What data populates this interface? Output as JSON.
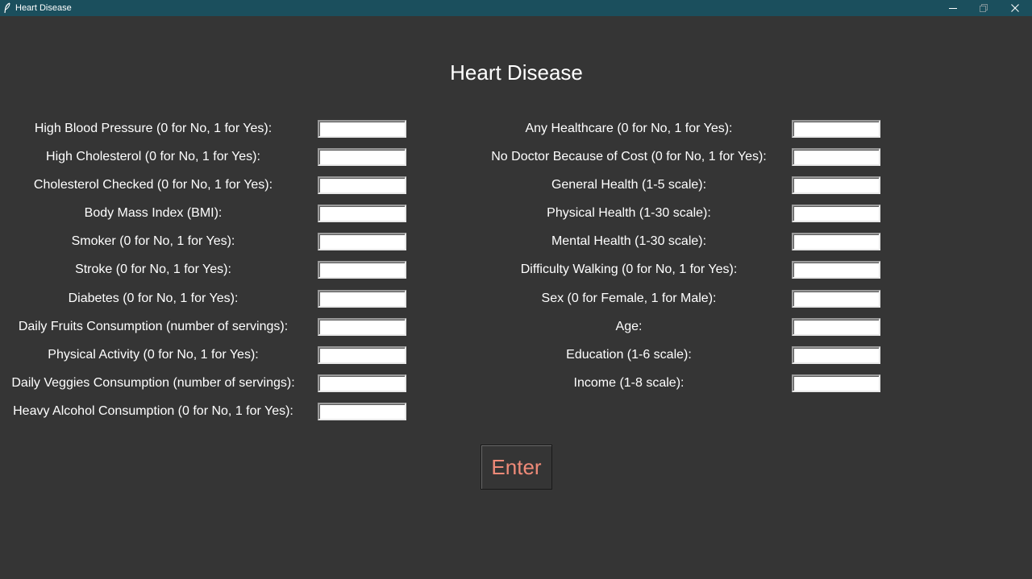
{
  "window": {
    "title": "Heart Disease"
  },
  "app": {
    "title": "Heart Disease",
    "enter_label": "Enter",
    "accent_color": "#ef8a78",
    "background_color": "#353535",
    "titlebar_color": "#1b4f5d"
  },
  "left_fields": [
    {
      "label": "High Blood Pressure (0 for No, 1 for Yes):",
      "value": ""
    },
    {
      "label": "High Cholesterol (0 for No, 1 for Yes):",
      "value": ""
    },
    {
      "label": "Cholesterol Checked (0 for No, 1 for Yes):",
      "value": ""
    },
    {
      "label": "Body Mass Index (BMI):",
      "value": ""
    },
    {
      "label": "Smoker (0 for No, 1 for Yes):",
      "value": ""
    },
    {
      "label": "Stroke (0 for No, 1 for Yes):",
      "value": ""
    },
    {
      "label": "Diabetes (0 for No, 1 for Yes):",
      "value": ""
    },
    {
      "label": "Daily Fruits Consumption (number of servings):",
      "value": ""
    },
    {
      "label": "Physical Activity (0 for No, 1 for Yes):",
      "value": ""
    },
    {
      "label": "Daily Veggies Consumption (number of servings):",
      "value": ""
    },
    {
      "label": "Heavy Alcohol Consumption (0 for No, 1 for Yes):",
      "value": ""
    }
  ],
  "right_fields": [
    {
      "label": "Any Healthcare (0 for No, 1 for Yes):",
      "value": ""
    },
    {
      "label": "No Doctor Because of Cost (0 for No, 1 for Yes):",
      "value": ""
    },
    {
      "label": "General Health (1-5 scale):",
      "value": ""
    },
    {
      "label": "Physical Health (1-30 scale):",
      "value": ""
    },
    {
      "label": "Mental Health (1-30 scale):",
      "value": ""
    },
    {
      "label": "Difficulty Walking (0 for No, 1 for Yes):",
      "value": ""
    },
    {
      "label": "Sex (0 for Female, 1 for Male):",
      "value": ""
    },
    {
      "label": "Age:",
      "value": ""
    },
    {
      "label": "Education (1-6 scale):",
      "value": ""
    },
    {
      "label": "Income (1-8 scale):",
      "value": ""
    }
  ],
  "icons": {
    "app": "feather-icon",
    "minimize": "minimize-icon",
    "maximize": "maximize-icon",
    "close": "close-icon"
  }
}
